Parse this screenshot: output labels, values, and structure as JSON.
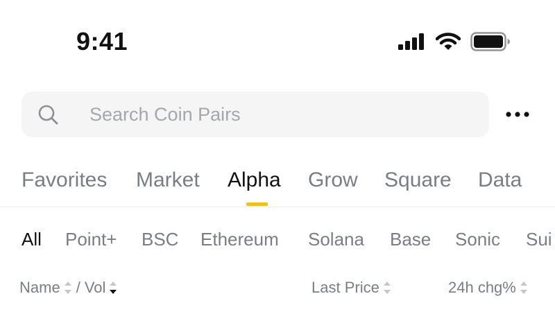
{
  "status_bar": {
    "time": "9:41"
  },
  "search": {
    "placeholder": "Search Coin Pairs"
  },
  "main_tabs": [
    {
      "label": "Favorites"
    },
    {
      "label": "Market"
    },
    {
      "label": "Alpha",
      "active": true
    },
    {
      "label": "Grow"
    },
    {
      "label": "Square"
    },
    {
      "label": "Data"
    }
  ],
  "chain_tabs": [
    {
      "label": "All",
      "active": true
    },
    {
      "label": "Point+"
    },
    {
      "label": "BSC"
    },
    {
      "label": "Ethereum"
    },
    {
      "label": "Solana"
    },
    {
      "label": "Base"
    },
    {
      "label": "Sonic"
    },
    {
      "label": "Sui"
    }
  ],
  "sort_header": {
    "name": "Name",
    "separator": "/",
    "vol": "Vol",
    "last_price": "Last Price",
    "change": "24h chg%"
  },
  "colors": {
    "accent": "#f0c020",
    "text_primary": "#111111",
    "text_secondary": "#787d86",
    "search_bg": "#f5f5f5"
  },
  "icons": {
    "search": "search-icon",
    "more": "more-dots-icon",
    "signal": "cellular-signal-icon",
    "wifi": "wifi-icon",
    "battery": "battery-icon"
  }
}
